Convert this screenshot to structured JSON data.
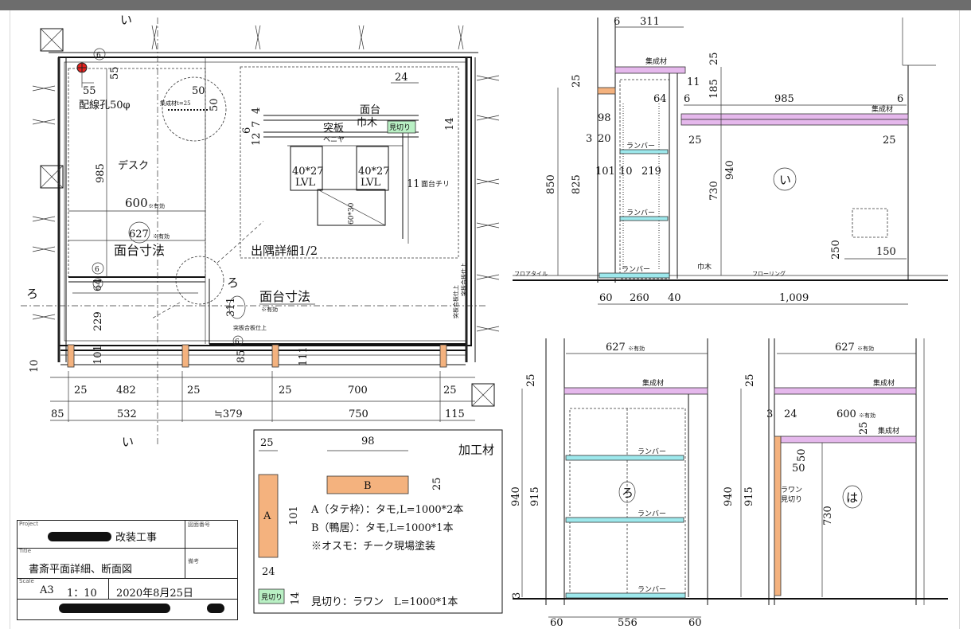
{
  "plan": {
    "section_marks": {
      "i_top": "い",
      "i_bottom": "い",
      "ro_left": "ろ",
      "ro_right": "ろ"
    },
    "dims": {
      "d55a": "55",
      "d55b": "55",
      "wiring_hole": "配線孔50φ",
      "d985": "985",
      "desk": "デスク",
      "d600": "600",
      "d627": "627",
      "eff": "※有効",
      "top_dim_label": "面台寸法",
      "d311": "311",
      "top_dim_label2": "面台寸法",
      "eff2": "※有効",
      "d6_circle_a": "6",
      "d6_circle_b": "6",
      "d6_circle_c": "6",
      "d6_circle_d": "6",
      "d64": "64",
      "d229": "229",
      "d101": "101",
      "d85v": "85",
      "d111": "111",
      "d10": "10",
      "b25a": "25",
      "b482": "482",
      "b25b": "25",
      "b25c": "25",
      "b700": "700",
      "b25d": "25",
      "c85": "85",
      "c532": "532",
      "c379": "≒379",
      "c750": "750",
      "c115": "115",
      "veneer_finish1": "突板合板仕上",
      "veneer_finish2": "突板合板仕上",
      "veneer_finish3": "突板合板仕上",
      "glulam_t25": "集成材t=25",
      "d50": "50",
      "d50v": "50"
    },
    "detail": {
      "title": "出隅詳細1/2",
      "d24": "24",
      "menndai": "面台",
      "haba": "巾木",
      "tsukiita": "突板",
      "benya": "ベニヤ",
      "mikiri": "見切り",
      "d14": "14",
      "d4": "4",
      "d7": "7",
      "d12": "12",
      "d6": "6",
      "lvl1": "40*27",
      "lvl1b": "LVL",
      "lvl2": "40*27",
      "lvl2b": "LVL",
      "d60x30": "60*30",
      "d11": "11",
      "chiri": "面台チリ"
    }
  },
  "section_i": {
    "d6": "6",
    "d311": "311",
    "d25": "25",
    "d11": "11",
    "d64": "64",
    "d6b": "6",
    "d985": "985",
    "d6c": "6",
    "d185": "185",
    "d98": "98",
    "d3": "3",
    "d20": "20",
    "d101": "101",
    "d10": "10",
    "d219": "219",
    "d850": "850",
    "d825": "825",
    "d940": "940",
    "d730": "730",
    "d25b": "25",
    "d25c": "25",
    "d250": "250",
    "d150": "150",
    "glulam1": "集成材",
    "glulam2": "集成材",
    "lumber1": "ランバー",
    "lumber2": "ランバー",
    "lumber3": "ランバー",
    "floor_tile": "フロアタイル",
    "baseboard": "巾木",
    "flooring": "フローリング",
    "mark": "い",
    "b60": "60",
    "b260": "260",
    "b40": "40",
    "b1009": "1,009"
  },
  "section_ro": {
    "d627": "627",
    "eff": "※有効",
    "d25": "25",
    "glulam": "集成材",
    "lumber1": "ランバー",
    "lumber2": "ランバー",
    "lumber3": "ランバー",
    "d940": "940",
    "d915": "915",
    "d3": "3",
    "mark": "ろ",
    "b60a": "60",
    "b556": "556",
    "b60b": "60"
  },
  "section_ha": {
    "d627": "627",
    "eff": "※有効",
    "d25": "25",
    "glulam1": "集成材",
    "d3": "3",
    "d24": "24",
    "d600": "600",
    "eff2": "※有効",
    "d25b": "25",
    "glulam2": "集成材",
    "d50": "50",
    "d50b": "50",
    "lauan": "ラワン",
    "mikiri": "見切り",
    "d940": "940",
    "d915": "915",
    "d730": "730",
    "mark": "は"
  },
  "materials": {
    "title": "加工材",
    "d25": "25",
    "d98": "98",
    "d25b": "25",
    "d101": "101",
    "d24": "24",
    "d14": "14",
    "label_a": "A",
    "label_b": "B",
    "mikiri": "見切り",
    "line_a": "A（タテ枠）：タモ,L=1000*2本",
    "line_b": "B（鴨居）：タモ,L=1000*1本",
    "line_c": "※オスモ：チーク現場塗装",
    "line_d": "見切り：ラワン　L=1000*1本"
  },
  "title_block": {
    "project_caption": "Project",
    "project": "改装工事",
    "drawing_no_caption": "図面番号",
    "title_caption": "Title",
    "title": "書斎平面詳細、断面図",
    "notes_caption": "備考",
    "scale_caption": "Scale",
    "paper": "A3",
    "scale": "1：10",
    "date": "2020年8月25日"
  }
}
